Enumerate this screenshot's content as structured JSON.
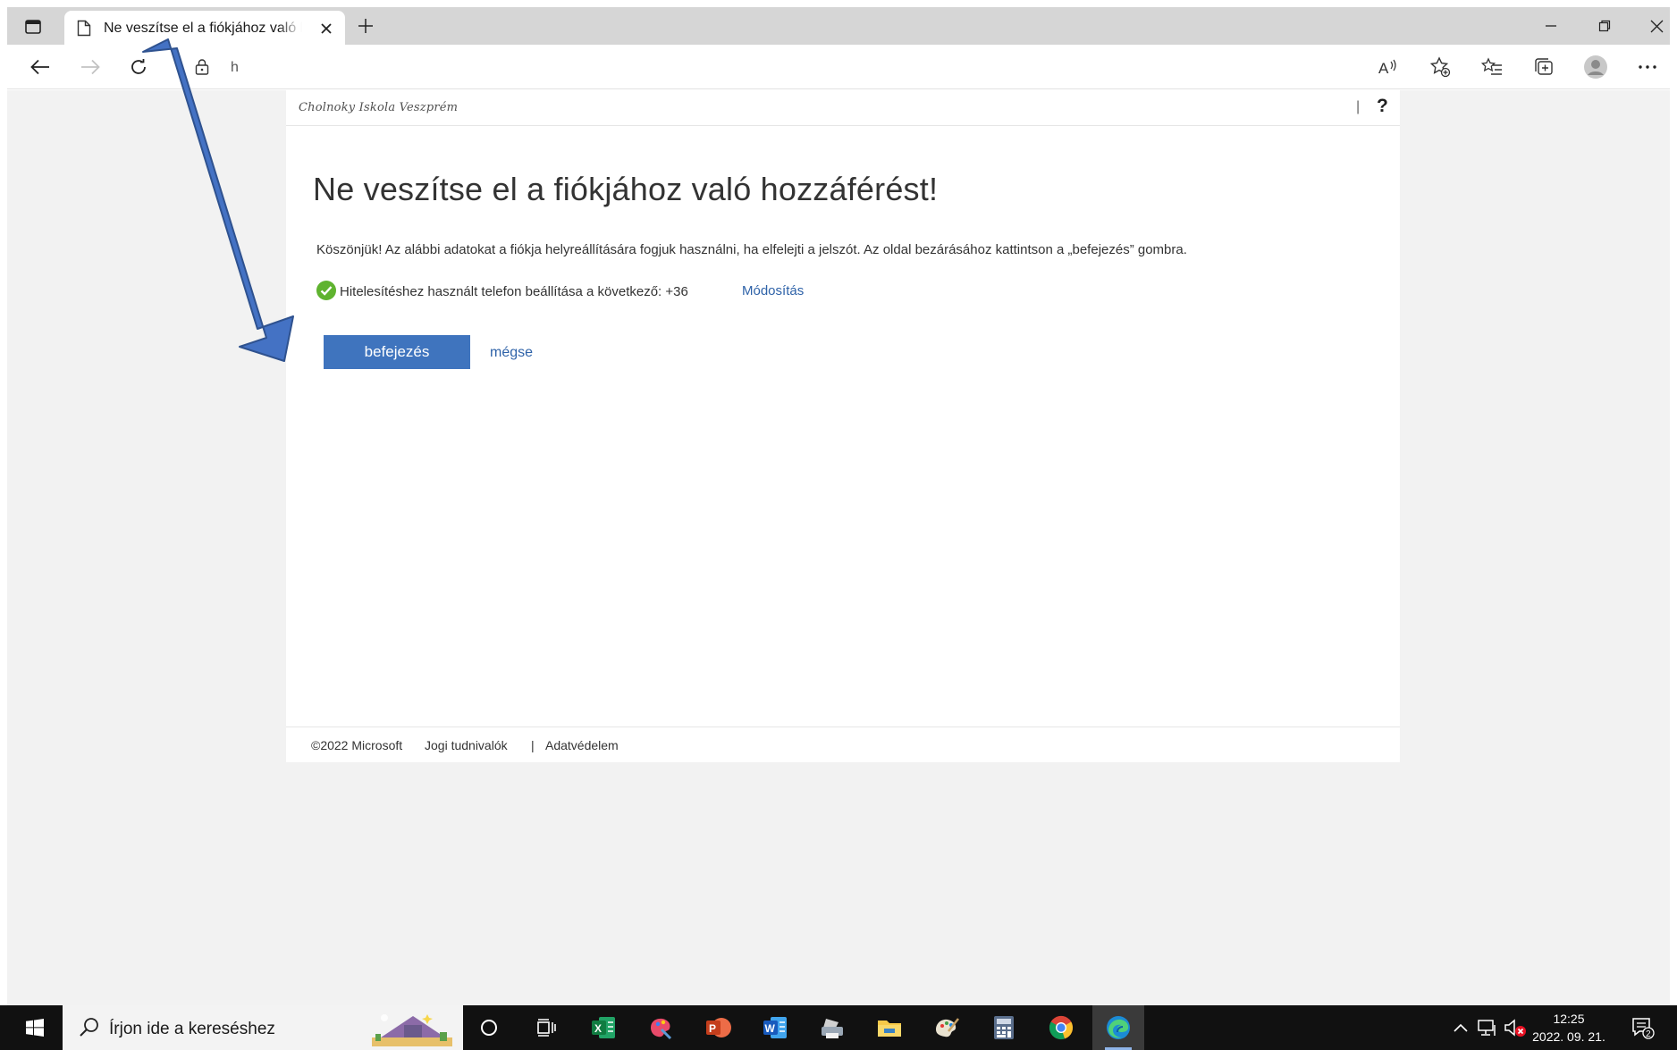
{
  "browser": {
    "tab_title": "Ne veszítse el a fiókjához való hozzáférést",
    "address_text": "h"
  },
  "page": {
    "org_name": "Cholnoky Iskola Veszprém",
    "help_separator": "|",
    "help_label": "?",
    "heading": "Ne veszítse el a fiókjához való hozzáférést!",
    "intro": "Köszönjük! Az alábbi adatokat a fiókja helyreállítására fogjuk használni, ha elfelejti a jelszót. Az oldal bezárásához kattintson a „befejezés” gombra.",
    "phone_status": "Hitelesítéshez használt telefon beállítása a következő: +36",
    "modify_label": "Módosítás",
    "finish_label": "befejezés",
    "cancel_label": "mégse",
    "footer": {
      "copyright": "©2022 Microsoft",
      "legal": "Jogi tudnivalók",
      "separator": "|",
      "privacy": "Adatvédelem"
    }
  },
  "taskbar": {
    "search_placeholder": "Írjon ide a kereséshez",
    "time": "12:25",
    "date": "2022. 09. 21.",
    "notification_count": "2",
    "apps": [
      "cortana-icon",
      "task-view-icon",
      "excel-icon",
      "paint-3d-icon",
      "powerpoint-icon",
      "word-icon",
      "printer-icon",
      "file-explorer-icon",
      "paint-icon",
      "calculator-icon",
      "chrome-icon",
      "edge-icon"
    ]
  },
  "colors": {
    "primary_button": "#3f74be",
    "link": "#2e62a8",
    "success": "#5fb32f",
    "annotation_arrow": "#3f6cc4"
  }
}
